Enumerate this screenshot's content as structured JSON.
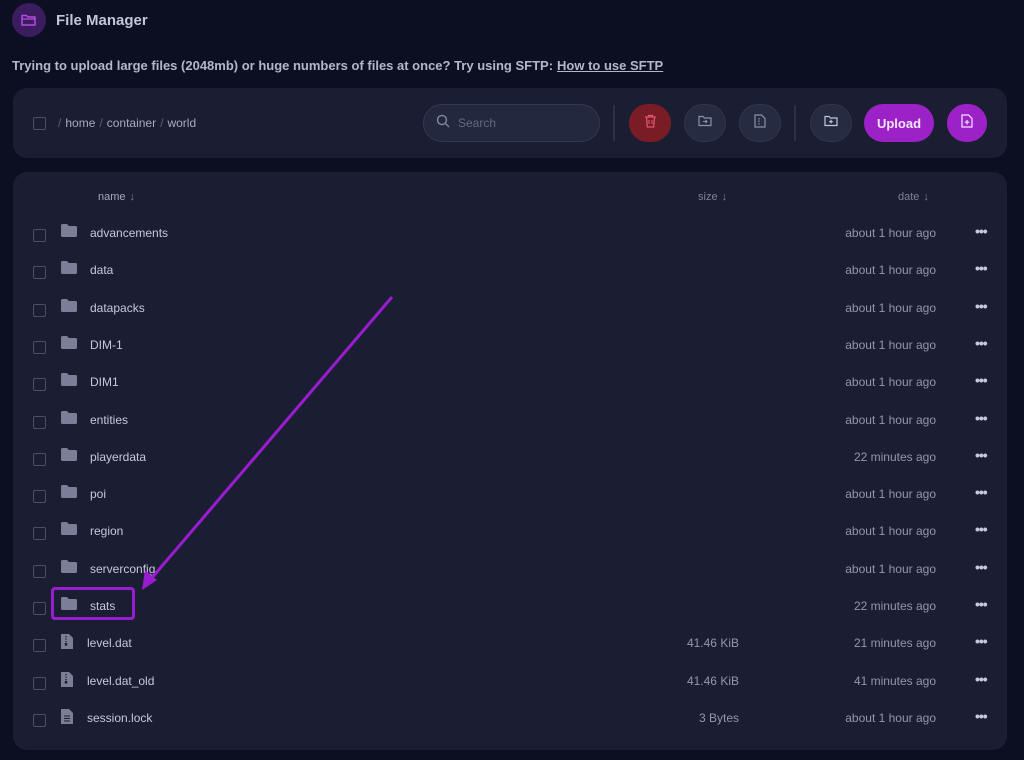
{
  "app": {
    "title": "File Manager",
    "icon": "folder-open-icon"
  },
  "notice": {
    "text": "Trying to upload large files (2048mb) or huge numbers of files at once? Try using SFTP:",
    "link": "How to use SFTP"
  },
  "toolbar": {
    "breadcrumb": [
      "home",
      "container",
      "world"
    ],
    "search_placeholder": "Search",
    "upload_label": "Upload",
    "icons": [
      "trash-icon",
      "folder-move-icon",
      "file-archive-icon",
      "folder-plus-icon",
      "file-plus-icon"
    ]
  },
  "columns": {
    "name": "name",
    "size": "size",
    "date": "date",
    "sort_arrow": "↓"
  },
  "files": [
    {
      "name": "advancements",
      "type": "folder",
      "size": "",
      "date": "about 1 hour ago"
    },
    {
      "name": "data",
      "type": "folder",
      "size": "",
      "date": "about 1 hour ago"
    },
    {
      "name": "datapacks",
      "type": "folder",
      "size": "",
      "date": "about 1 hour ago"
    },
    {
      "name": "DIM-1",
      "type": "folder",
      "size": "",
      "date": "about 1 hour ago"
    },
    {
      "name": "DIM1",
      "type": "folder",
      "size": "",
      "date": "about 1 hour ago"
    },
    {
      "name": "entities",
      "type": "folder",
      "size": "",
      "date": "about 1 hour ago"
    },
    {
      "name": "playerdata",
      "type": "folder",
      "size": "",
      "date": "22 minutes ago"
    },
    {
      "name": "poi",
      "type": "folder",
      "size": "",
      "date": "about 1 hour ago"
    },
    {
      "name": "region",
      "type": "folder",
      "size": "",
      "date": "about 1 hour ago"
    },
    {
      "name": "serverconfig",
      "type": "folder",
      "size": "",
      "date": "about 1 hour ago"
    },
    {
      "name": "stats",
      "type": "folder",
      "size": "",
      "date": "22 minutes ago"
    },
    {
      "name": "level.dat",
      "type": "archive",
      "size": "41.46 KiB",
      "date": "21 minutes ago"
    },
    {
      "name": "level.dat_old",
      "type": "archive",
      "size": "41.46 KiB",
      "date": "41 minutes ago"
    },
    {
      "name": "session.lock",
      "type": "file",
      "size": "3 Bytes",
      "date": "about 1 hour ago"
    }
  ],
  "colors": {
    "accent": "#9c22c8",
    "danger": "#7a1c26",
    "annotation": "#9a1cd1"
  }
}
